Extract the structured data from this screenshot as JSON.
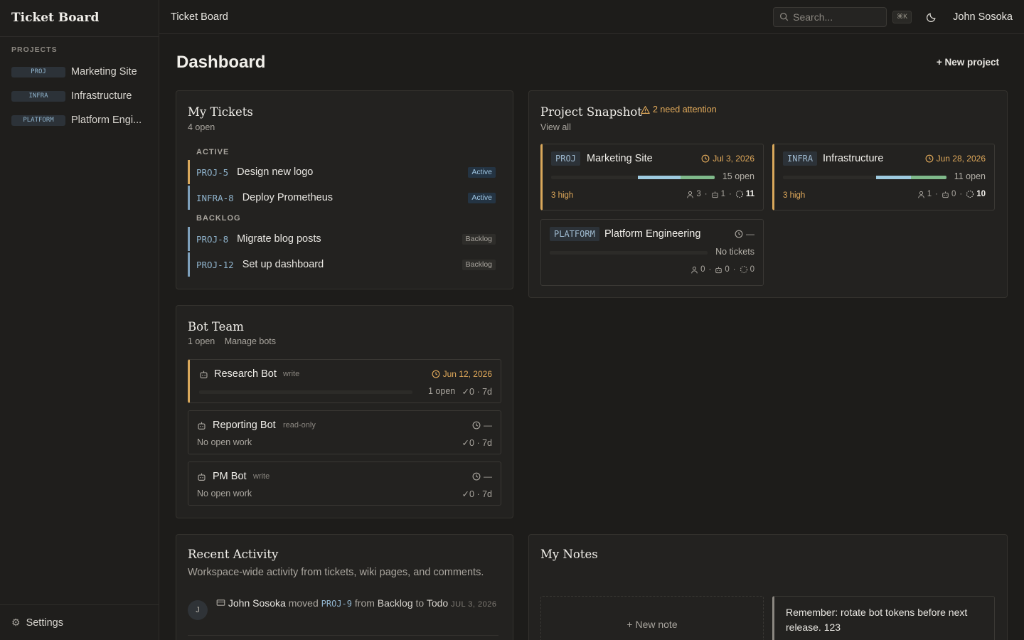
{
  "app": {
    "brand": "Ticket Board"
  },
  "sidebar": {
    "section_label": "PROJECTS",
    "projects": [
      {
        "key": "PROJ",
        "name": "Marketing Site"
      },
      {
        "key": "INFRA",
        "name": "Infrastructure"
      },
      {
        "key": "PLATFORM",
        "name": "Platform Engi..."
      }
    ],
    "settings_label": "Settings"
  },
  "topbar": {
    "title": "Ticket Board",
    "search_placeholder": "Search...",
    "shortcut": "⌘K",
    "user_name": "John Sosoka"
  },
  "main": {
    "title": "Dashboard",
    "new_project_label": "+ New project"
  },
  "my_tickets": {
    "title": "My Tickets",
    "subtitle": "4 open",
    "groups": [
      {
        "label": "ACTIVE",
        "tickets": [
          {
            "key": "PROJ-5",
            "title": "Design new logo",
            "status": "Active"
          },
          {
            "key": "INFRA-8",
            "title": "Deploy Prometheus",
            "status": "Active"
          }
        ]
      },
      {
        "label": "BACKLOG",
        "tickets": [
          {
            "key": "PROJ-8",
            "title": "Migrate blog posts",
            "status": "Backlog"
          },
          {
            "key": "PROJ-12",
            "title": "Set up dashboard",
            "status": "Backlog"
          }
        ]
      }
    ]
  },
  "snapshot": {
    "title": "Project Snapshot",
    "attention": "2 need attention",
    "view_all": "View all",
    "projects": [
      {
        "key": "PROJ",
        "name": "Marketing Site",
        "due": "Jul 3, 2026",
        "open": "15 open",
        "high": "3 high",
        "people": "3",
        "bots": "1",
        "total": "11",
        "progress": {
          "blue": 0.55,
          "green": 0.45,
          "filled": 0.47
        }
      },
      {
        "key": "INFRA",
        "name": "Infrastructure",
        "due": "Jun 28, 2026",
        "open": "11 open",
        "high": "3 high",
        "people": "1",
        "bots": "0",
        "total": "10",
        "progress": {
          "blue": 0.5,
          "green": 0.5,
          "filled": 0.43
        }
      },
      {
        "key": "PLATFORM",
        "name": "Platform Engineering",
        "due": "—",
        "open": "No tickets",
        "high": "",
        "people": "0",
        "bots": "0",
        "total": "0",
        "progress": {
          "blue": 0,
          "green": 0,
          "filled": 0
        }
      }
    ]
  },
  "bot_team": {
    "title": "Bot Team",
    "open": "1 open",
    "manage": "Manage bots",
    "bots": [
      {
        "name": "Research Bot",
        "perm": "write",
        "due": "Jun 12, 2026",
        "line2": "1 open",
        "stats": "✓0 · 7d"
      },
      {
        "name": "Reporting Bot",
        "perm": "read-only",
        "due": "—",
        "line2": "No open work",
        "stats": "✓0 · 7d"
      },
      {
        "name": "PM Bot",
        "perm": "write",
        "due": "—",
        "line2": "No open work",
        "stats": "✓0 · 7d"
      }
    ]
  },
  "activity": {
    "title": "Recent Activity",
    "subtitle": "Workspace-wide activity from tickets, wiki pages, and comments.",
    "items": [
      {
        "avatar": "J",
        "who": "John Sosoka",
        "verb": "moved",
        "key": "PROJ-9",
        "from_word": "from",
        "from": "Backlog",
        "to_word": "to",
        "to": "Todo",
        "date": "JUL 3, 2026"
      }
    ]
  },
  "notes": {
    "title": "My Notes",
    "new_label": "+ New note",
    "items": [
      {
        "text": "Remember: rotate bot tokens before next release. 123"
      }
    ]
  },
  "colors": {
    "accent_warn": "#e0a95a",
    "key_blue": "#8fb3cc",
    "bar_blue": "#9ecbe0",
    "bar_green": "#7fb98a"
  }
}
